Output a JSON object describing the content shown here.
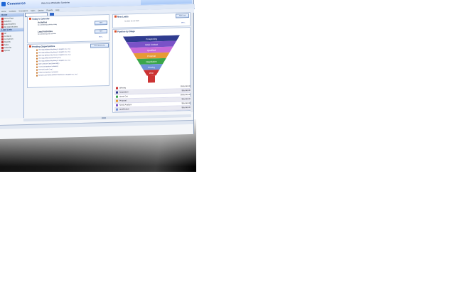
{
  "app": {
    "logo_text": "Commerce",
    "welcome": "Welcome Affordable Sunshine",
    "colors": {
      "accent": "#1d66d6",
      "header": "#cfe0fb",
      "sidebar": "#eef2f9"
    }
  },
  "menubar": {
    "items": [
      "Home",
      "Contacts",
      "Companies",
      "Sales",
      "Quotes",
      "Reports",
      "Help"
    ]
  },
  "toolbar": {
    "search_placeholder": "",
    "go_label": "Go"
  },
  "sidebar": {
    "sections": [
      {
        "title": "Home",
        "items": [
          "Home Page",
          "Activities",
          "Lead Activities",
          "My Opportunities"
        ]
      },
      {
        "title": "Lead Lists",
        "items": [
          "All",
          "Contacts",
          "Companies",
          "Reports",
          "Sales",
          "Calendar",
          "Quotes"
        ]
      }
    ]
  },
  "calendar": {
    "title": "Today's Calendar",
    "activities_title": "Activities",
    "activities_text": "No outstanding activities today",
    "activities_btn": "New",
    "lead_title": "Lead Activities",
    "lead_text": "No outstanding lead activities",
    "lead_btn": "New",
    "more": "More..."
  },
  "pending": {
    "title": "Pending Opportunities",
    "btn": "New Opportunity",
    "items": [
      "Test Opp (Midwest Machinery & Supplies Co., Inc.)",
      "Test Opp (Midwest Machinery & Supplies Co., Inc.)",
      "New Opp (Midwest Machinery & Supplies Co., Inc.)",
      "Test Opp (Allied Manufacturing Co.)",
      "Test Opp (Midwest Machinery & Supplies Co., Inc.)",
      "New Customer Opp (Jones Mfg.)",
      "IT Service (Northern Industries)",
      "Renewal (Smith Corp.)",
      "Follow Up (Northern Industries)",
      "Second Lead Follow (Midwest Machinery & Supplies Co., Inc.)"
    ]
  },
  "newleads": {
    "title": "New Leads",
    "btn": "New Lead",
    "text": "You have no new leads",
    "more": "More..."
  },
  "pipeline": {
    "title": "Pipeline by Stage",
    "stages": [
      {
        "name": "Prospecting",
        "color": "#2f3b8f"
      },
      {
        "name": "Initial Contact",
        "color": "#7a52c8"
      },
      {
        "name": "Qualified",
        "color": "#c86ad8"
      },
      {
        "name": "Proposal",
        "color": "#e79a35"
      },
      {
        "name": "Negotiation",
        "color": "#3aa64a"
      },
      {
        "name": "Closing",
        "color": "#6f92d8"
      },
      {
        "name": "Won",
        "color": "#cc3333"
      }
    ],
    "legend": [
      {
        "name": "Winning",
        "value": "$999,999.00",
        "color": "#cc3333"
      },
      {
        "name": "Negotiation",
        "value": "$99,999.00",
        "color": "#2f3b8f"
      },
      {
        "name": "Quote Out",
        "value": "$999,999.00",
        "color": "#3aa64a"
      },
      {
        "name": "Proposal",
        "value": "$99,999.00",
        "color": "#e79a35"
      },
      {
        "name": "Needs Analysis",
        "value": "$99,999.00",
        "color": "#7a52c8"
      },
      {
        "name": "Qualification",
        "value": "$99,999.00",
        "color": "#6f92d8"
      }
    ]
  }
}
